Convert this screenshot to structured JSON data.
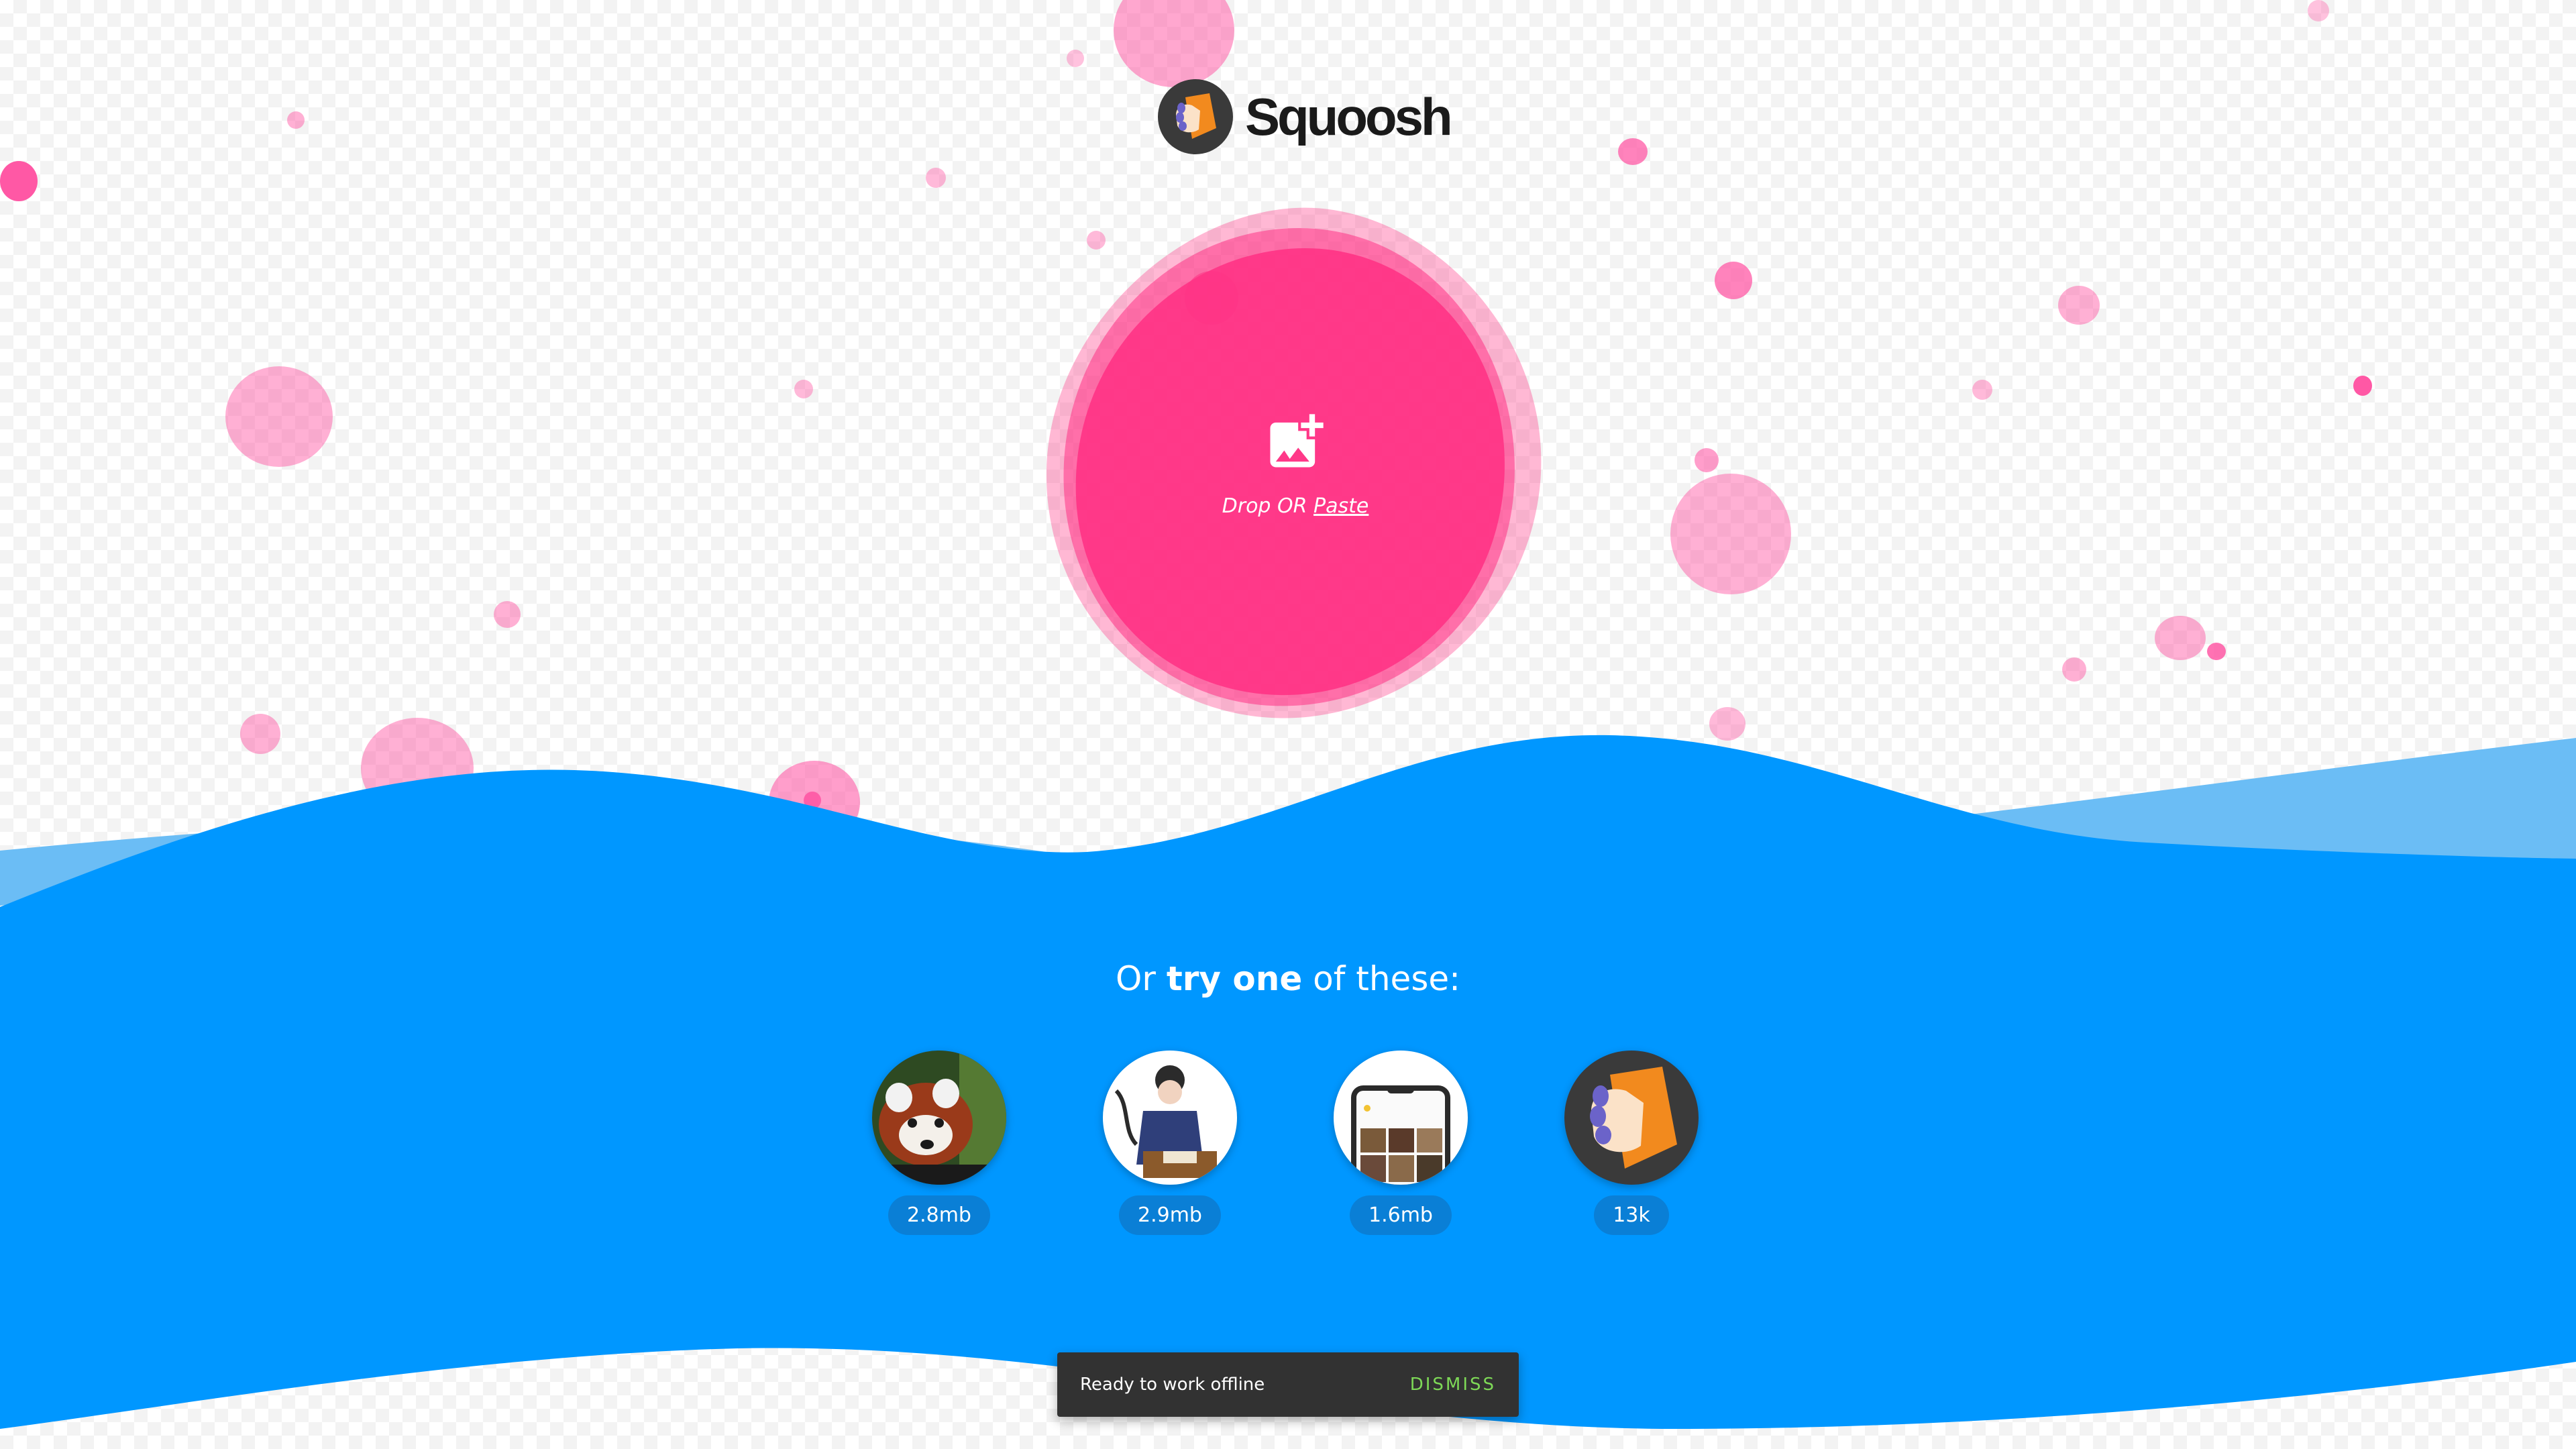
{
  "app": {
    "name": "Squoosh"
  },
  "dropzone": {
    "prefix": "Drop OR",
    "paste_label": "Paste"
  },
  "demos": {
    "heading_pre": "Or",
    "heading_bold": "try one",
    "heading_post": "of these:",
    "items": [
      {
        "name": "red-panda",
        "size": "2.8mb"
      },
      {
        "name": "illustration",
        "size": "2.9mb"
      },
      {
        "name": "device-screen",
        "size": "1.6mb"
      },
      {
        "name": "squoosh-logo",
        "size": "13k"
      }
    ]
  },
  "snackbar": {
    "message": "Ready to work offline",
    "action": "DISMISS"
  },
  "colors": {
    "accent_pink": "#ff3385",
    "wave_blue": "#0097ff",
    "wave_light": "#6bbdf5",
    "snackbar_action": "#7ed957"
  }
}
